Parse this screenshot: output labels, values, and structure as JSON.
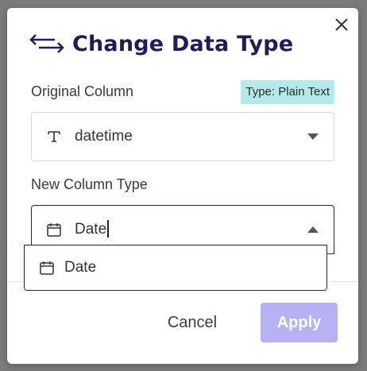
{
  "dialog": {
    "title": "Change Data Type",
    "title_icon": "swap-arrows-icon",
    "close_icon": "close-icon"
  },
  "original_column": {
    "label": "Original Column",
    "type_badge": "Type: Plain Text",
    "value": "datetime",
    "icon": "text-type-icon",
    "arrow_icon": "caret-down-icon"
  },
  "new_column_type": {
    "label": "New Column Type",
    "value": "Date",
    "icon": "calendar-icon",
    "arrow_icon": "caret-up-icon",
    "options": [
      {
        "label": "Date",
        "icon": "calendar-icon"
      }
    ]
  },
  "footer": {
    "cancel_label": "Cancel",
    "apply_label": "Apply"
  },
  "colors": {
    "title": "#1f1c5a",
    "badge_bg": "#b5eaea",
    "apply_bg": "#b6b1f3",
    "focus_border": "#24216b"
  }
}
